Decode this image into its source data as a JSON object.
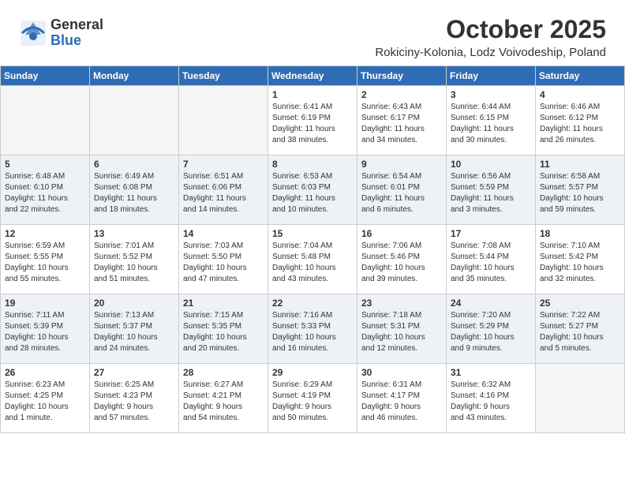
{
  "header": {
    "logo_general": "General",
    "logo_blue": "Blue",
    "month": "October 2025",
    "location": "Rokiciny-Kolonia, Lodz Voivodeship, Poland"
  },
  "weekdays": [
    "Sunday",
    "Monday",
    "Tuesday",
    "Wednesday",
    "Thursday",
    "Friday",
    "Saturday"
  ],
  "weeks": [
    [
      {
        "day": "",
        "info": ""
      },
      {
        "day": "",
        "info": ""
      },
      {
        "day": "",
        "info": ""
      },
      {
        "day": "1",
        "info": "Sunrise: 6:41 AM\nSunset: 6:19 PM\nDaylight: 11 hours\nand 38 minutes."
      },
      {
        "day": "2",
        "info": "Sunrise: 6:43 AM\nSunset: 6:17 PM\nDaylight: 11 hours\nand 34 minutes."
      },
      {
        "day": "3",
        "info": "Sunrise: 6:44 AM\nSunset: 6:15 PM\nDaylight: 11 hours\nand 30 minutes."
      },
      {
        "day": "4",
        "info": "Sunrise: 6:46 AM\nSunset: 6:12 PM\nDaylight: 11 hours\nand 26 minutes."
      }
    ],
    [
      {
        "day": "5",
        "info": "Sunrise: 6:48 AM\nSunset: 6:10 PM\nDaylight: 11 hours\nand 22 minutes."
      },
      {
        "day": "6",
        "info": "Sunrise: 6:49 AM\nSunset: 6:08 PM\nDaylight: 11 hours\nand 18 minutes."
      },
      {
        "day": "7",
        "info": "Sunrise: 6:51 AM\nSunset: 6:06 PM\nDaylight: 11 hours\nand 14 minutes."
      },
      {
        "day": "8",
        "info": "Sunrise: 6:53 AM\nSunset: 6:03 PM\nDaylight: 11 hours\nand 10 minutes."
      },
      {
        "day": "9",
        "info": "Sunrise: 6:54 AM\nSunset: 6:01 PM\nDaylight: 11 hours\nand 6 minutes."
      },
      {
        "day": "10",
        "info": "Sunrise: 6:56 AM\nSunset: 5:59 PM\nDaylight: 11 hours\nand 3 minutes."
      },
      {
        "day": "11",
        "info": "Sunrise: 6:58 AM\nSunset: 5:57 PM\nDaylight: 10 hours\nand 59 minutes."
      }
    ],
    [
      {
        "day": "12",
        "info": "Sunrise: 6:59 AM\nSunset: 5:55 PM\nDaylight: 10 hours\nand 55 minutes."
      },
      {
        "day": "13",
        "info": "Sunrise: 7:01 AM\nSunset: 5:52 PM\nDaylight: 10 hours\nand 51 minutes."
      },
      {
        "day": "14",
        "info": "Sunrise: 7:03 AM\nSunset: 5:50 PM\nDaylight: 10 hours\nand 47 minutes."
      },
      {
        "day": "15",
        "info": "Sunrise: 7:04 AM\nSunset: 5:48 PM\nDaylight: 10 hours\nand 43 minutes."
      },
      {
        "day": "16",
        "info": "Sunrise: 7:06 AM\nSunset: 5:46 PM\nDaylight: 10 hours\nand 39 minutes."
      },
      {
        "day": "17",
        "info": "Sunrise: 7:08 AM\nSunset: 5:44 PM\nDaylight: 10 hours\nand 35 minutes."
      },
      {
        "day": "18",
        "info": "Sunrise: 7:10 AM\nSunset: 5:42 PM\nDaylight: 10 hours\nand 32 minutes."
      }
    ],
    [
      {
        "day": "19",
        "info": "Sunrise: 7:11 AM\nSunset: 5:39 PM\nDaylight: 10 hours\nand 28 minutes."
      },
      {
        "day": "20",
        "info": "Sunrise: 7:13 AM\nSunset: 5:37 PM\nDaylight: 10 hours\nand 24 minutes."
      },
      {
        "day": "21",
        "info": "Sunrise: 7:15 AM\nSunset: 5:35 PM\nDaylight: 10 hours\nand 20 minutes."
      },
      {
        "day": "22",
        "info": "Sunrise: 7:16 AM\nSunset: 5:33 PM\nDaylight: 10 hours\nand 16 minutes."
      },
      {
        "day": "23",
        "info": "Sunrise: 7:18 AM\nSunset: 5:31 PM\nDaylight: 10 hours\nand 12 minutes."
      },
      {
        "day": "24",
        "info": "Sunrise: 7:20 AM\nSunset: 5:29 PM\nDaylight: 10 hours\nand 9 minutes."
      },
      {
        "day": "25",
        "info": "Sunrise: 7:22 AM\nSunset: 5:27 PM\nDaylight: 10 hours\nand 5 minutes."
      }
    ],
    [
      {
        "day": "26",
        "info": "Sunrise: 6:23 AM\nSunset: 4:25 PM\nDaylight: 10 hours\nand 1 minute."
      },
      {
        "day": "27",
        "info": "Sunrise: 6:25 AM\nSunset: 4:23 PM\nDaylight: 9 hours\nand 57 minutes."
      },
      {
        "day": "28",
        "info": "Sunrise: 6:27 AM\nSunset: 4:21 PM\nDaylight: 9 hours\nand 54 minutes."
      },
      {
        "day": "29",
        "info": "Sunrise: 6:29 AM\nSunset: 4:19 PM\nDaylight: 9 hours\nand 50 minutes."
      },
      {
        "day": "30",
        "info": "Sunrise: 6:31 AM\nSunset: 4:17 PM\nDaylight: 9 hours\nand 46 minutes."
      },
      {
        "day": "31",
        "info": "Sunrise: 6:32 AM\nSunset: 4:16 PM\nDaylight: 9 hours\nand 43 minutes."
      },
      {
        "day": "",
        "info": ""
      }
    ]
  ]
}
